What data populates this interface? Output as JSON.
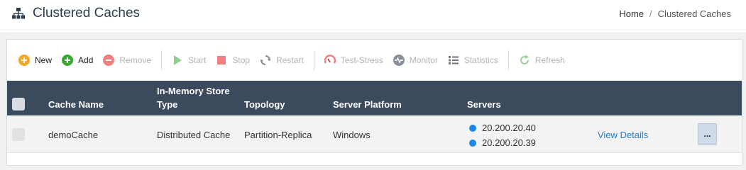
{
  "page": {
    "title": "Clustered Caches",
    "title_icon": "sitemap-icon"
  },
  "breadcrumb": {
    "home": "Home",
    "separator": "/",
    "current": "Clustered Caches"
  },
  "toolbar": {
    "new": "New",
    "add": "Add",
    "remove": "Remove",
    "start": "Start",
    "stop": "Stop",
    "restart": "Restart",
    "test_stress": "Test-Stress",
    "monitor": "Monitor",
    "statistics": "Statistics",
    "refresh": "Refresh"
  },
  "table": {
    "headers": {
      "cache_name": "Cache Name",
      "store_type_line1": "In-Memory Store",
      "store_type_line2": "Type",
      "topology": "Topology",
      "server_platform": "Server Platform",
      "servers": "Servers"
    },
    "rows": [
      {
        "cache_name": "demoCache",
        "store_type": "Distributed Cache",
        "topology": "Partition-Replica",
        "platform": "Windows",
        "servers": [
          "20.200.20.40",
          "20.200.20.39"
        ],
        "details_link": "View Details",
        "more_label": "..."
      }
    ]
  },
  "colors": {
    "header_bg": "#3b4a5c",
    "link": "#1e7fd0",
    "server_dot": "#1e88e5",
    "new_icon": "#f5a623",
    "add_icon": "#3aaa35",
    "remove_icon": "#f08080",
    "start_icon": "#8fd08f",
    "stop_icon": "#f08080"
  }
}
